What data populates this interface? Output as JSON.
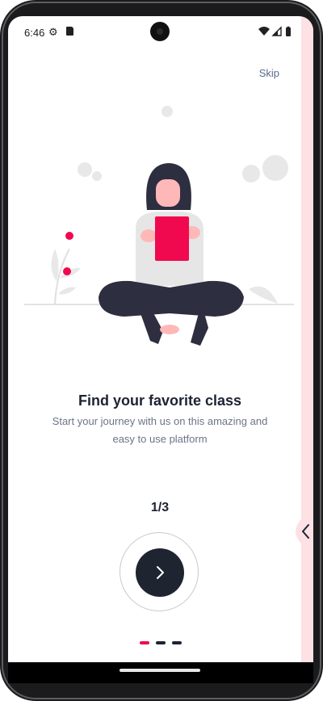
{
  "status_bar": {
    "time": "6:46",
    "icons": [
      "settings-gear-icon",
      "sd-card-icon",
      "wifi-icon",
      "cellular-signal-icon",
      "battery-icon"
    ]
  },
  "onboarding": {
    "skip_label": "Skip",
    "title": "Find your favorite class",
    "subtitle": "Start your journey with us on this amazing and easy to use platform",
    "page_indicator": "1/3",
    "current_page": 1,
    "total_pages": 3
  },
  "colors": {
    "accent": "#f0094f",
    "dark": "#1e2430",
    "side_strip": "#fde1e4",
    "text_primary": "#1e2233",
    "text_secondary": "#6b7488"
  }
}
